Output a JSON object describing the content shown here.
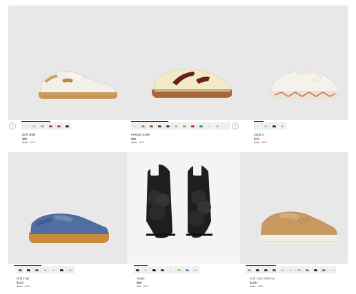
{
  "products": [
    {
      "name": "Drift Walk",
      "price": "$82",
      "old_price": "$165",
      "discount": "-50%",
      "shoe_icon": "white-sneaker-icon",
      "swatch_colors": [
        "#efeae2",
        "#b9c4d4",
        "#c9a07a",
        "#b04040",
        "#c33a4a",
        "#2a2a2a"
      ]
    },
    {
      "name": "Pelotas Soller",
      "price": "$82",
      "old_price": "$165",
      "discount": "-50%",
      "shoe_icon": "cream-burgundy-sneaker-icon",
      "swatch_colors": [
        "#e8dcc0",
        "#c87a6a",
        "#8a5a3a",
        "#2f5a3a",
        "#5a3a2a",
        "#e6b07a",
        "#c79a6a",
        "#c0303a",
        "#4a7ab0",
        "#e0e0e0",
        "#c9c9c9",
        "#ededed"
      ]
    },
    {
      "name": "Karst 2",
      "price": "$72",
      "old_price": "$145",
      "discount": "-50%",
      "shoe_icon": "white-mesh-sneaker-icon",
      "swatch_colors": [
        "#f2ede6",
        "#c7c7c7",
        "#2c2c2c",
        "#e6b7b7"
      ]
    },
    {
      "name": "Drift Trail",
      "price": "$103",
      "old_price": "$185",
      "discount": "-44%",
      "shoe_icon": "blue-trail-sneaker-icon",
      "swatch_colors": [
        "#3c5a8a",
        "#2a2a2a",
        "#5a6a3a",
        "#c9c9c9",
        "#e9d7a7",
        "#1f1f1f",
        "#d9c2b0"
      ]
    },
    {
      "name": "Twins",
      "price": "$65",
      "old_price": "$95",
      "discount": "-32%",
      "shoe_icon": "black-flower-sandal-icon",
      "swatch_colors": [
        "#2a2a2a",
        "#d9d9d9",
        "#111111",
        "#3a3a3a",
        "#e9e9e9",
        "#a7c98a",
        "#5a8ab0",
        "#d0d0d0"
      ]
    },
    {
      "name": "Drift Trail VIBRAM",
      "price": "$105",
      "old_price": "$185",
      "discount": "-43%",
      "shoe_icon": "tan-suede-sneaker-icon",
      "swatch_colors": [
        "#c79a6a",
        "#2a2a2a",
        "#3a3a3a",
        "#5a4a3a",
        "#c9c9c9",
        "#e9d7c7",
        "#d8b08a",
        "#b07a5a",
        "#1f1f1f",
        "#7a7a7a",
        "#e0e0e0"
      ]
    }
  ],
  "nav": {
    "prev_arrow": "‹",
    "next_arrow": "›"
  }
}
